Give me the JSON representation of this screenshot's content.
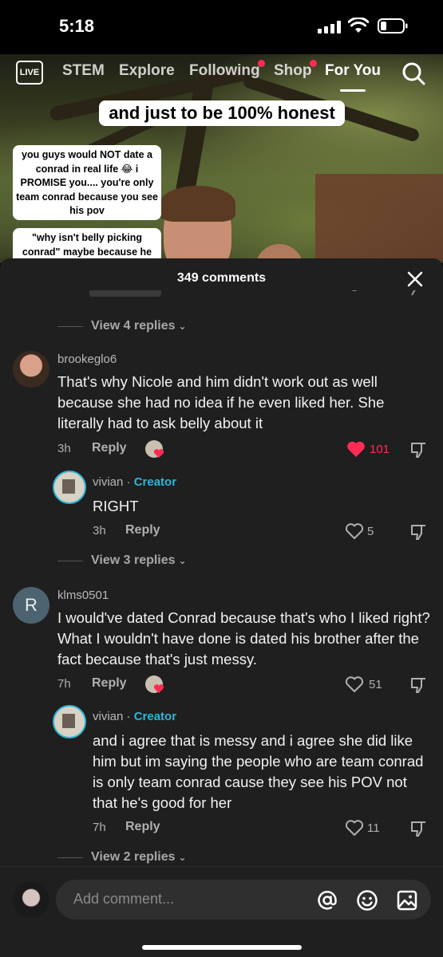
{
  "status_bar": {
    "time": "5:18"
  },
  "nav": {
    "live_label": "LIVE",
    "tabs": [
      {
        "label": "STEM"
      },
      {
        "label": "Explore"
      },
      {
        "label": "Following"
      },
      {
        "label": "Shop"
      },
      {
        "label": "For You"
      }
    ]
  },
  "video": {
    "caption_main": "and just to be 100% honest",
    "caption_left_1": "you guys would NOT date a conrad in real life 😂 i PROMISE you.... you're only team conrad because you see his pov",
    "caption_left_2": "\"why isn't belly picking conrad\" maybe because he"
  },
  "comments_sheet": {
    "title": "349 comments",
    "comments": [
      {
        "view_replies_label": "View 4 replies"
      },
      {
        "username": "brookeglo6",
        "text": "That's why Nicole and him didn't work out as well because she had no idea if he even liked her. She literally had to ask belly about it",
        "time": "3h",
        "reply_label": "Reply",
        "likes": "101",
        "reply": {
          "username": "vivian",
          "creator_label": "Creator",
          "text": "RIGHT",
          "time": "3h",
          "reply_label": "Reply",
          "likes": "5"
        },
        "view_replies_label": "View 3 replies"
      },
      {
        "username": "klms0501",
        "avatar_initial": "R",
        "text": "I would've dated Conrad because that's who I liked right? What I wouldn't have done is dated his brother after the fact because that's just messy.",
        "time": "7h",
        "reply_label": "Reply",
        "likes": "51",
        "reply": {
          "username": "vivian",
          "creator_label": "Creator",
          "text": "and i agree that is messy and i agree she did like him but im saying the people who are team conrad is only team conrad cause they see his POV not that he's good for her",
          "time": "7h",
          "reply_label": "Reply",
          "likes": "11"
        },
        "view_replies_label": "View 2 replies"
      }
    ]
  },
  "comment_input": {
    "placeholder": "Add comment..."
  },
  "colors": {
    "accent_red": "#fe2c55",
    "creator_blue": "#2fb5d6",
    "sheet_bg": "#1f1f1f"
  }
}
